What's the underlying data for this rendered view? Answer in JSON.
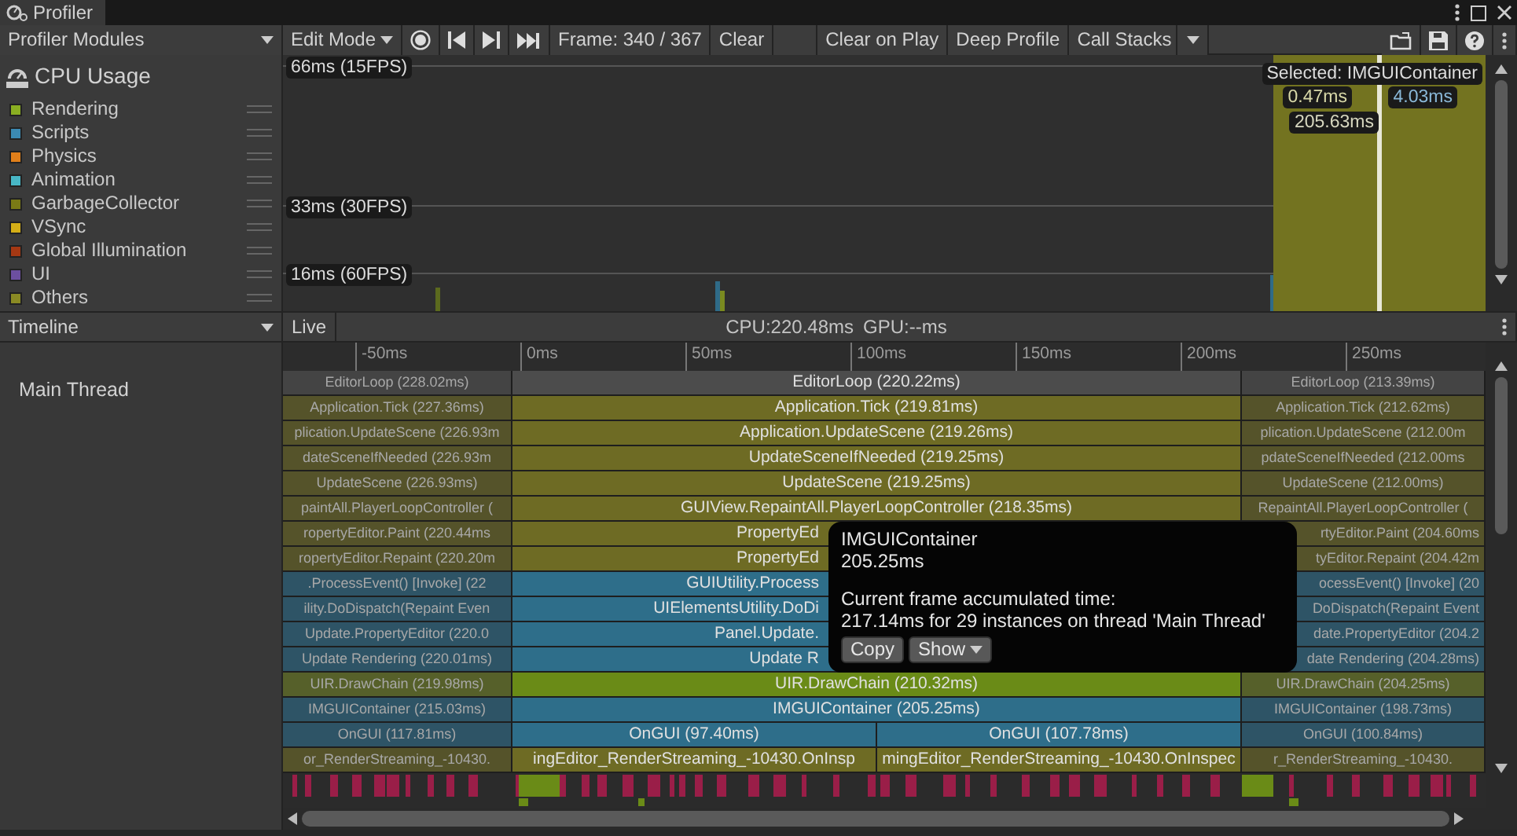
{
  "window": {
    "title": "Profiler"
  },
  "toolbar": {
    "modules": "Profiler Modules",
    "mode": "Edit Mode",
    "frame": "Frame: 340 / 367",
    "buttons": [
      "Clear",
      "Clear on Play",
      "Deep Profile"
    ],
    "call_stacks": "Call Stacks"
  },
  "module": {
    "title": "CPU Usage",
    "categories": [
      {
        "name": "Rendering",
        "color": "#8aae22"
      },
      {
        "name": "Scripts",
        "color": "#3b8ab3"
      },
      {
        "name": "Physics",
        "color": "#e07f1a"
      },
      {
        "name": "Animation",
        "color": "#48b7c6"
      },
      {
        "name": "GarbageCollector",
        "color": "#7a7a16"
      },
      {
        "name": "VSync",
        "color": "#d4ae17"
      },
      {
        "name": "Global Illumination",
        "color": "#a53813"
      },
      {
        "name": "UI",
        "color": "#6c4fa0"
      },
      {
        "name": "Others",
        "color": "#8a8a24"
      }
    ]
  },
  "chart": {
    "gridlines": [
      "66ms (15FPS)",
      "33ms (30FPS)",
      "16ms (60FPS)"
    ],
    "selected": "Selected: IMGUIContainer",
    "readings": [
      "0.47ms",
      "4.03ms",
      "205.63ms"
    ]
  },
  "timeline": {
    "view": "Timeline",
    "live": "Live",
    "cpu": "CPU:220.48ms",
    "gpu": "GPU:--ms",
    "thread": "Main Thread",
    "ticks": [
      "-50ms",
      "0ms",
      "50ms",
      "100ms",
      "150ms",
      "200ms",
      "250ms"
    ],
    "rows": [
      {
        "kind": "editor",
        "previous": "EditorLoop (228.02ms)",
        "current": [
          "EditorLoop (220.22ms)"
        ],
        "next": "EditorLoop (213.39ms)"
      },
      {
        "kind": "other",
        "previous": "Application.Tick (227.36ms)",
        "current": [
          "Application.Tick (219.81ms)"
        ],
        "next": "Application.Tick (212.62ms)"
      },
      {
        "kind": "other",
        "previous": "plication.UpdateScene (226.93m",
        "current": [
          "Application.UpdateScene (219.26ms)"
        ],
        "next": "plication.UpdateScene (212.00m"
      },
      {
        "kind": "other",
        "previous": "dateSceneIfNeeded (226.93m",
        "current": [
          "UpdateSceneIfNeeded (219.25ms)"
        ],
        "next": "pdateSceneIfNeeded (212.00ms"
      },
      {
        "kind": "other",
        "previous": "UpdateScene (226.93ms)",
        "current": [
          "UpdateScene (219.25ms)"
        ],
        "next": "UpdateScene (212.00ms)"
      },
      {
        "kind": "other",
        "previous": "paintAll.PlayerLoopController (",
        "current": [
          "GUIView.RepaintAll.PlayerLoopController (218.35ms)"
        ],
        "next": "RepaintAll.PlayerLoopController ("
      },
      {
        "kind": "other",
        "previous": "ropertyEditor.Paint (220.44ms",
        "current": [
          "PropertyEd"
        ],
        "next": "rtyEditor.Paint (204.60ms"
      },
      {
        "kind": "other",
        "previous": "ropertyEditor.Repaint (220.20m",
        "current": [
          "PropertyEd"
        ],
        "next": "tyEditor.Repaint (204.42m"
      },
      {
        "kind": "scripts",
        "previous": ".ProcessEvent() [Invoke] (22",
        "current": [
          "GUIUtility.Process"
        ],
        "next": "ocessEvent() [Invoke] (20"
      },
      {
        "kind": "scripts",
        "previous": "ility.DoDispatch(Repaint Even",
        "current": [
          "UIElementsUtility.DoDi"
        ],
        "next": "DoDispatch(Repaint Event"
      },
      {
        "kind": "scripts",
        "previous": "Update.PropertyEditor (220.0",
        "current": [
          "Panel.Update."
        ],
        "next": "date.PropertyEditor (204.2"
      },
      {
        "kind": "scripts",
        "previous": "Update Rendering (220.01ms)",
        "current": [
          "Update R"
        ],
        "next": "date Rendering (204.28ms)"
      },
      {
        "kind": "rendering",
        "previous": "UIR.DrawChain (219.98ms)",
        "current": [
          "UIR.DrawChain (210.32ms)"
        ],
        "next": "UIR.DrawChain (204.25ms)"
      },
      {
        "kind": "scripts",
        "previous": "IMGUIContainer (215.03ms)",
        "current": [
          "IMGUIContainer (205.25ms)"
        ],
        "next": "IMGUIContainer (198.73ms)"
      },
      {
        "kind": "scripts",
        "previous": "OnGUI (117.81ms)",
        "current": [
          "OnGUI (97.40ms)",
          "OnGUI (107.78ms)"
        ],
        "next": "OnGUI (100.84ms)"
      },
      {
        "kind": "other",
        "previous": "or_RenderStreaming_-10430.",
        "current": [
          "ingEditor_RenderStreaming_-10430.OnInsp",
          "mingEditor_RenderStreaming_-10430.OnInspec"
        ],
        "next": "r_RenderStreaming_-10430."
      }
    ]
  },
  "tooltip": {
    "name": "IMGUIContainer",
    "time": "205.25ms",
    "heading": "Current frame accumulated time:",
    "detail": "217.14ms for 29 instances on thread 'Main Thread'",
    "buttons": [
      "Copy",
      "Show"
    ]
  }
}
